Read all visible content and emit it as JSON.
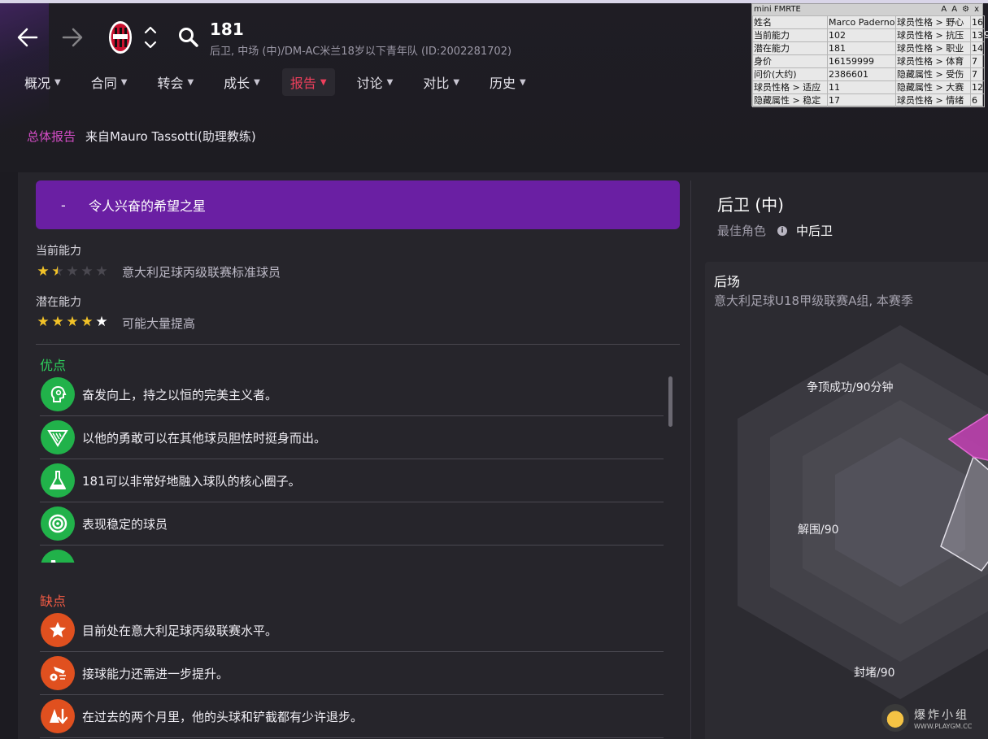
{
  "header": {
    "player_name": "181",
    "player_subtitle": "后卫, 中场 (中)/DM-AC米兰18岁以下青年队 (ID:2002281702)",
    "icons": {
      "back": "back-arrow-icon",
      "forward": "forward-arrow-icon",
      "club": "ac-milan-crest-icon",
      "switch": "up-down-chevron-icon",
      "search": "search-icon"
    }
  },
  "tabs": [
    {
      "label": "概况",
      "active": false
    },
    {
      "label": "合同",
      "active": false
    },
    {
      "label": "转会",
      "active": false
    },
    {
      "label": "成长",
      "active": false
    },
    {
      "label": "报告",
      "active": true
    },
    {
      "label": "讨论",
      "active": false
    },
    {
      "label": "对比",
      "active": false
    },
    {
      "label": "历史",
      "active": false
    }
  ],
  "report": {
    "kind": "总体报告",
    "from": "来自Mauro Tassotti(助理教练)",
    "banner_dash": "-",
    "banner_text": "令人兴奋的希望之星",
    "current_ability_label": "当前能力",
    "current_ability_stars": 1.5,
    "current_ability_desc": "意大利足球丙级联赛标准球员",
    "potential_ability_label": "潜在能力",
    "potential_ability_stars": 5,
    "potential_ability_desc": "可能大量提高"
  },
  "pros": {
    "title": "优点",
    "items": [
      {
        "text": "奋发向上，持之以恒的完美主义者。",
        "icon": "head-silhouette-icon"
      },
      {
        "text": "以他的勇敢可以在其他球员胆怯时挺身而出。",
        "icon": "shield-icon"
      },
      {
        "text": "181可以非常好地融入球队的核心圈子。",
        "icon": "flask-icon"
      },
      {
        "text": "表现稳定的球员",
        "icon": "target-icon"
      },
      {
        "text": "",
        "icon": "boot-icon"
      }
    ]
  },
  "cons": {
    "title": "缺点",
    "items": [
      {
        "text": "目前处在意大利足球丙级联赛水平。",
        "icon": "star-icon"
      },
      {
        "text": "接球能力还需进一步提升。",
        "icon": "ball-control-icon"
      },
      {
        "text": "在过去的两个月里，他的头球和铲截都有少许退步。",
        "icon": "decline-icon"
      }
    ]
  },
  "position": {
    "title": "后卫 (中)",
    "best_role_label": "最佳角色",
    "best_role_value": "中后卫",
    "info_icon": "info-icon"
  },
  "radar": {
    "title": "后场",
    "subtitle": "意大利足球U18甲级联赛A组, 本赛季",
    "labels": [
      "争顶成功/90分钟",
      "解围/90",
      "封堵/90"
    ]
  },
  "fmrte": {
    "title": "mini FMRTE",
    "controls": [
      "A",
      "A",
      "⚙",
      "x"
    ],
    "rows": [
      [
        "姓名",
        "Marco Paderno",
        "球员性格 > 野心",
        "16"
      ],
      [
        "当前能力",
        "102",
        "球员性格 > 抗压",
        "13"
      ],
      [
        "潜在能力",
        "181",
        "球员性格 > 职业",
        "14"
      ],
      [
        "身价",
        "16159999",
        "球员性格 > 体育",
        "7"
      ],
      [
        "问价(大约)",
        "2386601",
        "隐藏属性 > 受伤",
        "7"
      ],
      [
        "球员性格 > 适应",
        "11",
        "隐藏属性 > 大赛",
        "12"
      ],
      [
        "隐藏属性 > 稳定",
        "17",
        "球员性格 > 情绪",
        "6"
      ]
    ]
  },
  "watermark": {
    "cn": "爆炸小组",
    "url": "WWW.PLAYGM.CC"
  },
  "colors": {
    "accent_red": "#ef3f5c",
    "banner_purple": "#6a1fa3",
    "pros_green": "#2ed35c",
    "cons_orange": "#f05a44",
    "report_magenta": "#d54dc7"
  }
}
